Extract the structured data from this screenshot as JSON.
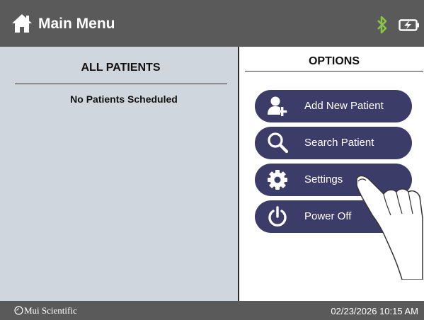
{
  "header": {
    "title": "Main Menu",
    "icons": [
      "home-icon",
      "bluetooth-icon",
      "battery-charging-icon"
    ],
    "bluetooth_color": "#8bc34a"
  },
  "patients": {
    "heading": "ALL PATIENTS",
    "empty_message": "No Patients Scheduled"
  },
  "options": {
    "heading": "OPTIONS",
    "buttons": [
      {
        "label": "Add New Patient",
        "icon": "add-user-icon"
      },
      {
        "label": "Search Patient",
        "icon": "search-icon"
      },
      {
        "label": "Settings",
        "icon": "gear-icon"
      },
      {
        "label": "Power Off",
        "icon": "power-icon"
      }
    ]
  },
  "footer": {
    "brand": "Mui Scientific",
    "datetime": "02/23/2026 10:15 AM"
  },
  "colors": {
    "header_bg": "#5a5a5a",
    "left_panel_bg": "#cfd6de",
    "button_bg": "#3c3c69"
  }
}
